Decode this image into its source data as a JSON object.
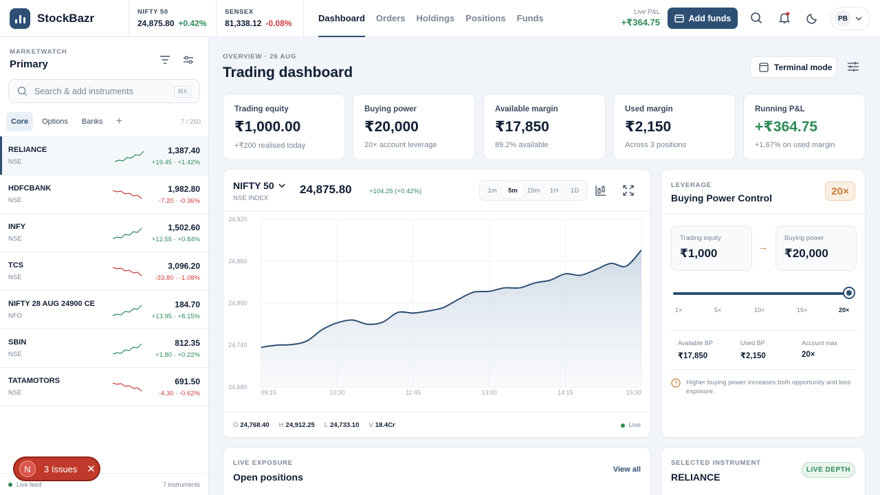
{
  "brand": {
    "name": "StockBazr"
  },
  "indices": [
    {
      "name": "NIFTY 50",
      "value": "24,875.80",
      "change": "+0.42%",
      "dir": "pos"
    },
    {
      "name": "SENSEX",
      "value": "81,338.12",
      "change": "-0.08%",
      "dir": "neg"
    }
  ],
  "nav": [
    {
      "label": "Dashboard",
      "active": true
    },
    {
      "label": "Orders"
    },
    {
      "label": "Holdings"
    },
    {
      "label": "Positions"
    },
    {
      "label": "Funds"
    }
  ],
  "header": {
    "live_pl_label": "Live P&L",
    "live_pl_value": "+₹364.75",
    "add_funds": "Add funds",
    "avatar": "PB"
  },
  "marketwatch": {
    "label": "MARKETWATCH",
    "title": "Primary",
    "search_placeholder": "Search & add instruments",
    "shortcut": "⌘K",
    "tabs": [
      "Core",
      "Options",
      "Banks"
    ],
    "count": "7 / 250",
    "items": [
      {
        "symbol": "RELIANCE",
        "exchange": "NSE",
        "price": "1,387.40",
        "change": "+19.45 · +1.42%",
        "dir": "pos",
        "selected": true
      },
      {
        "symbol": "HDFCBANK",
        "exchange": "NSE",
        "price": "1,982.80",
        "change": "-7.20 · -0.36%",
        "dir": "neg"
      },
      {
        "symbol": "INFY",
        "exchange": "NSE",
        "price": "1,502.60",
        "change": "+12.55 · +0.84%",
        "dir": "pos"
      },
      {
        "symbol": "TCS",
        "exchange": "NSE",
        "price": "3,096.20",
        "change": "-33.80 · -1.08%",
        "dir": "neg"
      },
      {
        "symbol": "NIFTY 28 AUG 24900 CE",
        "exchange": "NFO",
        "price": "184.70",
        "change": "+13.95 · +8.15%",
        "dir": "pos"
      },
      {
        "symbol": "SBIN",
        "exchange": "NSE",
        "price": "812.35",
        "change": "+1.80 · +0.22%",
        "dir": "pos"
      },
      {
        "symbol": "TATAMOTORS",
        "exchange": "NSE",
        "price": "691.50",
        "change": "-4.30 · -0.62%",
        "dir": "neg"
      }
    ],
    "footer_left": "Live feed",
    "footer_right": "7 instruments"
  },
  "issues": {
    "initial": "N",
    "label": "3 Issues",
    "close": "✕"
  },
  "overview": {
    "label": "OVERVIEW · 26 AUG",
    "title": "Trading dashboard",
    "terminal": "Terminal mode"
  },
  "cards": [
    {
      "label": "Trading equity",
      "value": "₹1,000.00",
      "sub": "+₹200 realised today",
      "sub_color": "pos"
    },
    {
      "label": "Buying power",
      "value": "₹20,000",
      "sub": "20× account leverage"
    },
    {
      "label": "Available margin",
      "value": "₹17,850",
      "sub": "89.2% available"
    },
    {
      "label": "Used margin",
      "value": "₹2,150",
      "sub": "Across 3 positions"
    },
    {
      "label": "Running P&L",
      "value": "+₹364.75",
      "sub": "+1.67% on used margin",
      "value_color": "pos"
    }
  ],
  "chart": {
    "symbol": "NIFTY 50",
    "sub": "NSE INDEX",
    "price": "24,875.80",
    "change": "+104.25 (+0.42%)",
    "timeframes": [
      "1m",
      "5m",
      "15m",
      "1H",
      "1D"
    ],
    "active_tf": "5m",
    "ohlc": [
      {
        "k": "O",
        "v": "24,768.40"
      },
      {
        "k": "H",
        "v": "24,912.25"
      },
      {
        "k": "L",
        "v": "24,733.10"
      },
      {
        "k": "V",
        "v": "18.4Cr"
      }
    ],
    "live": "Live"
  },
  "chart_data": {
    "type": "area",
    "title": "",
    "xlabel": "",
    "ylabel": "",
    "ylim": [
      24680,
      24920
    ],
    "y_ticks": [
      "24,920",
      "24,860",
      "24,800",
      "24,740",
      "24,680"
    ],
    "x_ticks": [
      "09:15",
      "10:30",
      "11:45",
      "13:00",
      "14:15",
      "15:30"
    ],
    "x": [
      "09:15",
      "09:30",
      "09:45",
      "10:00",
      "10:15",
      "10:30",
      "10:45",
      "11:00",
      "11:15",
      "11:30",
      "11:45",
      "12:00",
      "12:15",
      "12:30",
      "12:45",
      "13:00",
      "13:15",
      "13:30",
      "13:45",
      "14:00",
      "14:15",
      "14:30",
      "14:45",
      "15:00",
      "15:15",
      "15:30"
    ],
    "series": [
      {
        "values": [
          24737,
          24740,
          24741,
          24746,
          24762,
          24772,
          24776,
          24770,
          24773,
          24787,
          24786,
          24789,
          24794,
          24806,
          24816,
          24817,
          24822,
          24822,
          24829,
          24833,
          24842,
          24840,
          24848,
          24857,
          24853,
          24876
        ]
      }
    ],
    "grid": true,
    "legend": "none"
  },
  "bp": {
    "label": "LEVERAGE",
    "title": "Buying Power Control",
    "badge": "20×",
    "equity_label": "Trading equity",
    "equity_value": "₹1,000",
    "power_label": "Buying power",
    "power_value": "₹20,000",
    "arrow": "→",
    "levels": [
      "1×",
      "5×",
      "10×",
      "15×",
      "20×"
    ],
    "level_max": 20,
    "level_value": 20,
    "stats": [
      {
        "l": "Available BP",
        "v": "₹17,850"
      },
      {
        "l": "Used BP",
        "v": "₹2,150"
      },
      {
        "l": "Account max",
        "v": "20×"
      }
    ],
    "note": "Higher buying power increases both opportunity and loss exposure."
  },
  "positions": {
    "label": "LIVE EXPOSURE",
    "title": "Open positions",
    "view_all": "View all"
  },
  "selected": {
    "label": "SELECTED INSTRUMENT",
    "title": "RELIANCE",
    "badge": "LIVE DEPTH"
  },
  "colors": {
    "accent": "#2d4f73",
    "positive": "#2e8a57",
    "negative": "#cc3b3b",
    "leverage": "#c27a3a"
  }
}
